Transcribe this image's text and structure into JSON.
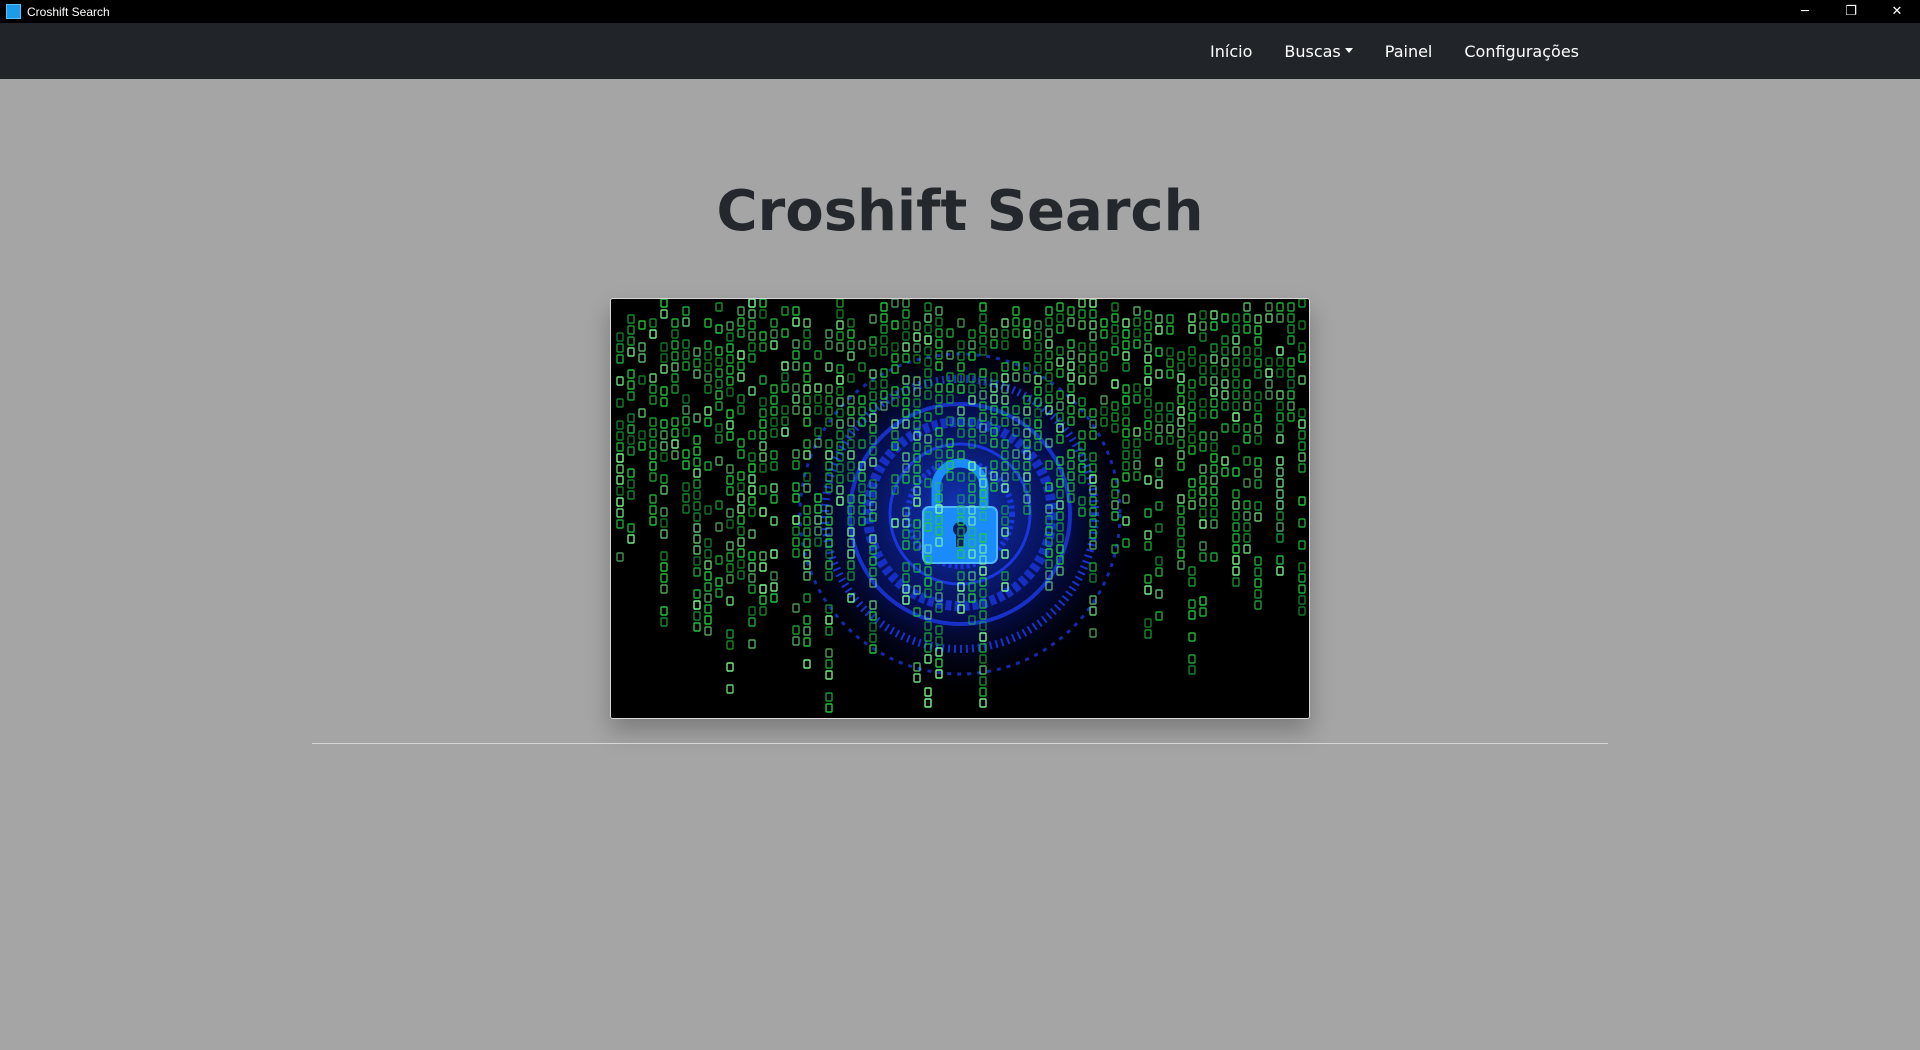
{
  "window": {
    "title": "Croshift Search",
    "controls": {
      "minimize": "─",
      "restore": "❐",
      "close": "✕"
    }
  },
  "navbar": {
    "items": [
      {
        "label": "Início",
        "has_dropdown": false
      },
      {
        "label": "Buscas",
        "has_dropdown": true
      },
      {
        "label": "Painel",
        "has_dropdown": false
      },
      {
        "label": "Configurações",
        "has_dropdown": false
      }
    ]
  },
  "main": {
    "heading": "Croshift Search",
    "hero_image": {
      "description_icon": "padlock-icon",
      "theme_colors": {
        "background": "#000000",
        "code_rain": "#27e04a",
        "lock": "#1a8cff",
        "rings": "#1533d8"
      }
    }
  },
  "colors": {
    "titlebar": "#000000",
    "navbar": "#212529",
    "page_background": "#a5a5a5",
    "heading": "#24282d"
  }
}
